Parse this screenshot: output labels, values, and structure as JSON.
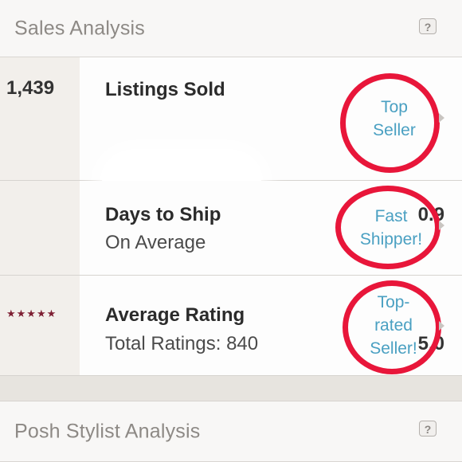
{
  "sections": {
    "sales": {
      "title": "Sales Analysis",
      "help_label": "?"
    },
    "posh": {
      "title": "Posh Stylist Analysis",
      "help_label": "?"
    }
  },
  "rows": [
    {
      "value": "1,439",
      "label": "Listings Sold",
      "sub": "",
      "badge_lines": [
        "Top",
        "Seller"
      ]
    },
    {
      "value": "0.9",
      "label": "Days to Ship",
      "sub": "On Average",
      "badge_lines": [
        "Fast",
        "Shipper!"
      ]
    },
    {
      "value": "5.0",
      "label": "Average Rating",
      "sub": "Total Ratings: 840",
      "badge_lines": [
        "Top-",
        "rated",
        "Seller!"
      ],
      "stars": "★★★★★",
      "rating": 5
    }
  ],
  "colors": {
    "highlight_circle": "#e8163a",
    "badge_text": "#4aa0c2",
    "stars": "#7e1f33"
  }
}
